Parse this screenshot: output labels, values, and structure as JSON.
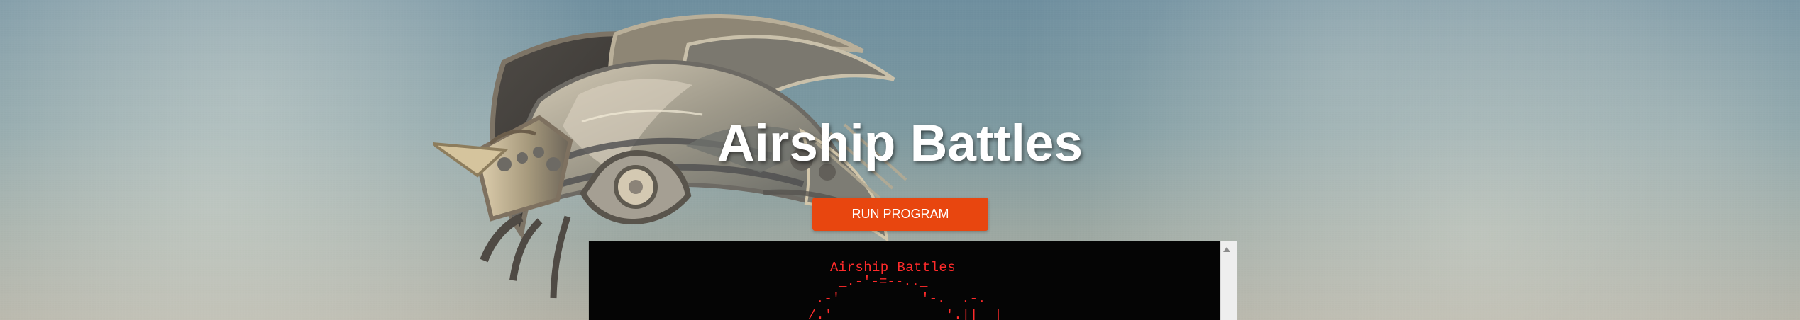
{
  "header": {
    "title": "Airship Battles"
  },
  "actions": {
    "run_program_label": "RUN PROGRAM"
  },
  "terminal": {
    "title": "Airship Battles",
    "ascii_lines": [
      "_.-'-=--.._",
      ".-'          '-.  .-.",
      "/.'              '.||  |"
    ]
  },
  "colors": {
    "accent": "#E8460F",
    "terminal_bg": "#050505",
    "terminal_text": "#FF2B2B",
    "title_text": "#FFFFFF"
  },
  "icons": {
    "scroll_up": "scroll-up-icon"
  }
}
